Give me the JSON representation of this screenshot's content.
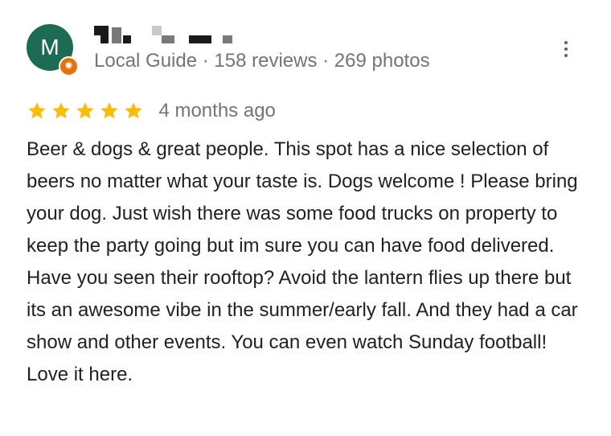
{
  "reviewer": {
    "avatar_initial": "M",
    "avatar_color": "#1e6b53",
    "badge_color": "#e8710a",
    "name_redacted": true,
    "meta": "Local Guide · 158 reviews · 269 photos"
  },
  "review": {
    "rating": 5,
    "rating_max": 5,
    "star_color": "#fbbc04",
    "date": "4 months ago",
    "text": "Beer & dogs & great people.  This spot has a nice selection of beers no matter what your taste is. Dogs welcome ! Please bring your dog.  Just wish there was some food trucks on property to keep the party going but im sure you can have food delivered.  Have you seen their rooftop? Avoid the lantern flies up there but its an awesome vibe in the summer/early fall. And they had a car show and other events. You can even watch Sunday football! Love it here."
  },
  "icons": {
    "more": "more-vertical-icon",
    "star": "star-icon",
    "badge": "local-guide-badge-icon"
  }
}
